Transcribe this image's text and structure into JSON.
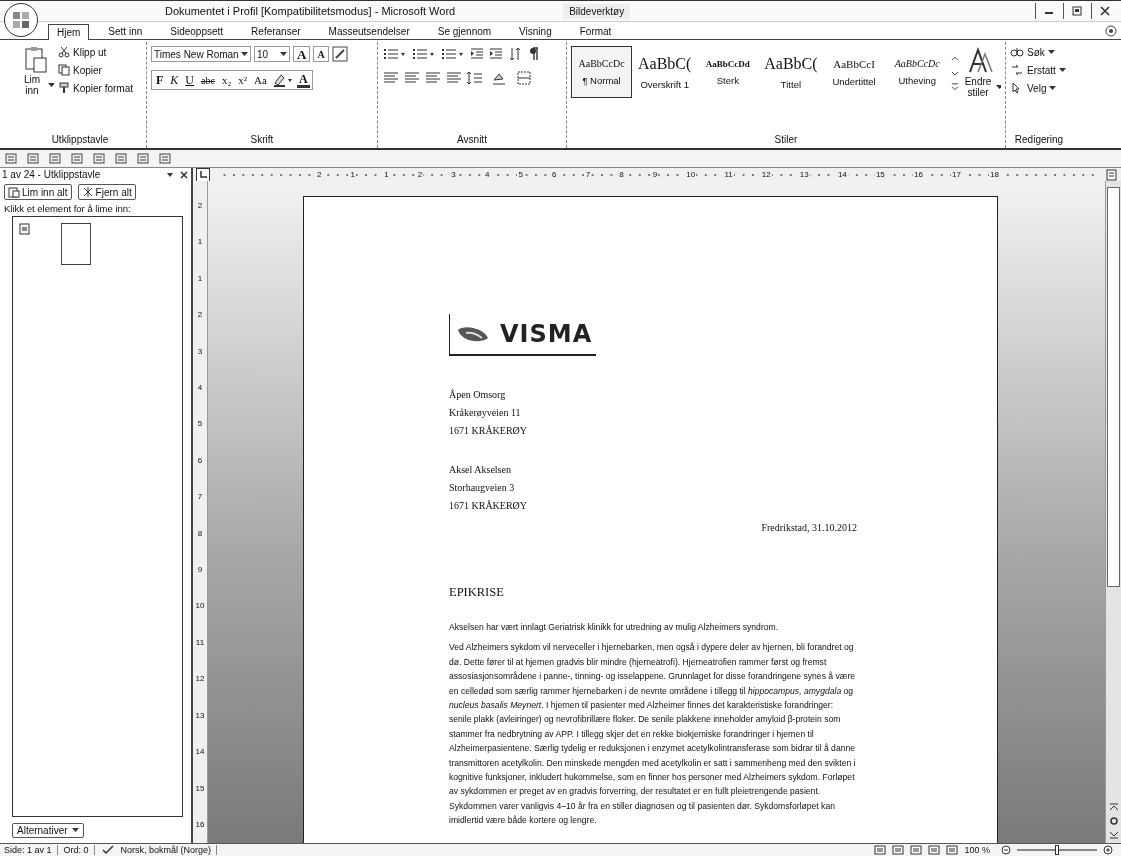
{
  "window": {
    "title": "Dokumentet i Profil [Kompatibilitetsmodus] - Microsoft Word",
    "context_tab_group": "Bildeverktøy"
  },
  "tabs": [
    {
      "label": "Hjem",
      "selected": true
    },
    {
      "label": "Sett inn",
      "selected": false
    },
    {
      "label": "Sideoppsett",
      "selected": false
    },
    {
      "label": "Referanser",
      "selected": false
    },
    {
      "label": "Masseutsendelser",
      "selected": false
    },
    {
      "label": "Se gjennom",
      "selected": false
    },
    {
      "label": "Visning",
      "selected": false
    },
    {
      "label": "Format",
      "selected": false
    }
  ],
  "ribbon": {
    "clipboard": {
      "paste": "Lim inn",
      "cut": "Klipp ut",
      "copy": "Kopier",
      "format_painter": "Kopier format",
      "label": "Utklippstavle"
    },
    "font": {
      "name": "Times New Roman",
      "size": "10",
      "grow": "A",
      "shrink": "A",
      "font_color": "A",
      "label": "Skrift",
      "format_buttons": [
        {
          "text": "F",
          "kind": "bold"
        },
        {
          "text": "K",
          "kind": "italic"
        },
        {
          "text": "U",
          "kind": "underline"
        },
        {
          "text": "abc",
          "kind": "strike"
        },
        {
          "text": "x₂",
          "kind": "subscript"
        },
        {
          "text": "x²",
          "kind": "superscript"
        },
        {
          "text": "Aa",
          "kind": "case"
        }
      ]
    },
    "paragraph": {
      "label": "Avsnitt"
    },
    "styles": {
      "label": "Stiler",
      "change_styles": "Endre stiler",
      "items": [
        {
          "preview": "AaBbCcDc",
          "name": "¶ Normal",
          "kind": "normal",
          "selected": true
        },
        {
          "preview": "AaBbC(",
          "name": "Overskrift 1",
          "kind": "heading",
          "selected": false
        },
        {
          "preview": "AaBbCcDd",
          "name": "Sterk",
          "kind": "strong",
          "selected": false
        },
        {
          "preview": "AaBbC(",
          "name": "Tittel",
          "kind": "title",
          "selected": false
        },
        {
          "preview": "AaBbCcI",
          "name": "Undertittel",
          "kind": "subtitle",
          "selected": false
        },
        {
          "preview": "AaBbCcDc",
          "name": "Utheving",
          "kind": "emphasis",
          "selected": false
        }
      ]
    },
    "editing": {
      "label": "Redigering",
      "items": [
        {
          "text": "Søk",
          "kind": "find"
        },
        {
          "text": "Erstatt",
          "kind": "replace"
        },
        {
          "text": "Velg",
          "kind": "select"
        }
      ]
    }
  },
  "clipboard_pane": {
    "title": "1 av 24 - Utklippstavle",
    "buttons": [
      {
        "text": "Lim inn alt",
        "kind": "paste"
      },
      {
        "text": "Fjern alt",
        "kind": "clear"
      }
    ],
    "hint": "Klikk et element for å lime inn:",
    "options": "Alternativer"
  },
  "rulers": {
    "horizontal": [
      "2",
      "1",
      "1",
      "2",
      "3",
      "4",
      "5",
      "6",
      "7",
      "8",
      "9",
      "10",
      "11",
      "12",
      "13",
      "14",
      "15",
      "16",
      "17",
      "18"
    ],
    "vertical": [
      "2",
      "1",
      "1",
      "2",
      "3",
      "4",
      "5",
      "6",
      "7",
      "8",
      "9",
      "10",
      "11",
      "12",
      "13",
      "14",
      "15",
      "16"
    ]
  },
  "document": {
    "logo": "VISMA",
    "sender": [
      "Åpen Omsorg",
      "Kråkerøyveien 11",
      "1671 KRÅKERØY"
    ],
    "recipient": [
      "Aksel Akselsen",
      "Storhaugveien 3",
      "1671 KRÅKERØY"
    ],
    "date": "Fredrikstad, 31.10.2012",
    "heading": "EPIKRISE",
    "paragraphs": [
      "Akselsen har vært innlagt Geriatrisk klinikk for utredning av mulig Alzheimers syndrom.",
      "Ved Alzheimers sykdom vil nerveceller i hjernebarken, men også i dypere deler av hjernen, bli forandret og dø. Dette fører til at hjernen gradvis blir mindre (hjerneatrofi). Hjerneatrofien rammer først og fremst assosiasjonsområdene i panne-, tinning- og isselappene. Grunnlaget for disse forandringene synes å være en celledød som særlig rammer hjernebarken i de nevnte områdene i tillegg til *hippocampus, amygdala* og *nucleus basalis Meynert*. I hjernen til pasienter med Alzheimer finnes det karakteristiske forandringer: senile plakk (avleiringer) og nevrofibrillære floker. De senile plakkene inneholder amyloid β-protein som stammer fra nedbrytning av APP. I tillegg skjer det en rekke biokjemiske forandringer i hjernen til Alzheimerpasientene. Særlig tydelig er reduksjonen i enzymet acetylkolintransferase som bidrar til å danne transmittoren acetylkolin. Den minskede mengden med acetylkolin er satt i sammenheng med den svikten i kognitive funksjoner, inkludert hukommelse, som en finner hos personer med Alzheimers sykdom. Forløpet av sykdommen er preget av en gradvis forverring, der resultatet er en fullt pleietrengende pasient. Sykdommen varer vanligvis 4–10 år fra en stiller diagnosen og til pasienten dør. Sykdomsforløpet kan imidlertid være både kortere og lengre."
    ]
  },
  "status_bar": {
    "page": "Side: 1 av 1",
    "words": "Ord: 0",
    "language": "Norsk, bokmål (Norge)",
    "zoom": "100 %",
    "zoom_slider": {
      "level": 0.5
    }
  }
}
